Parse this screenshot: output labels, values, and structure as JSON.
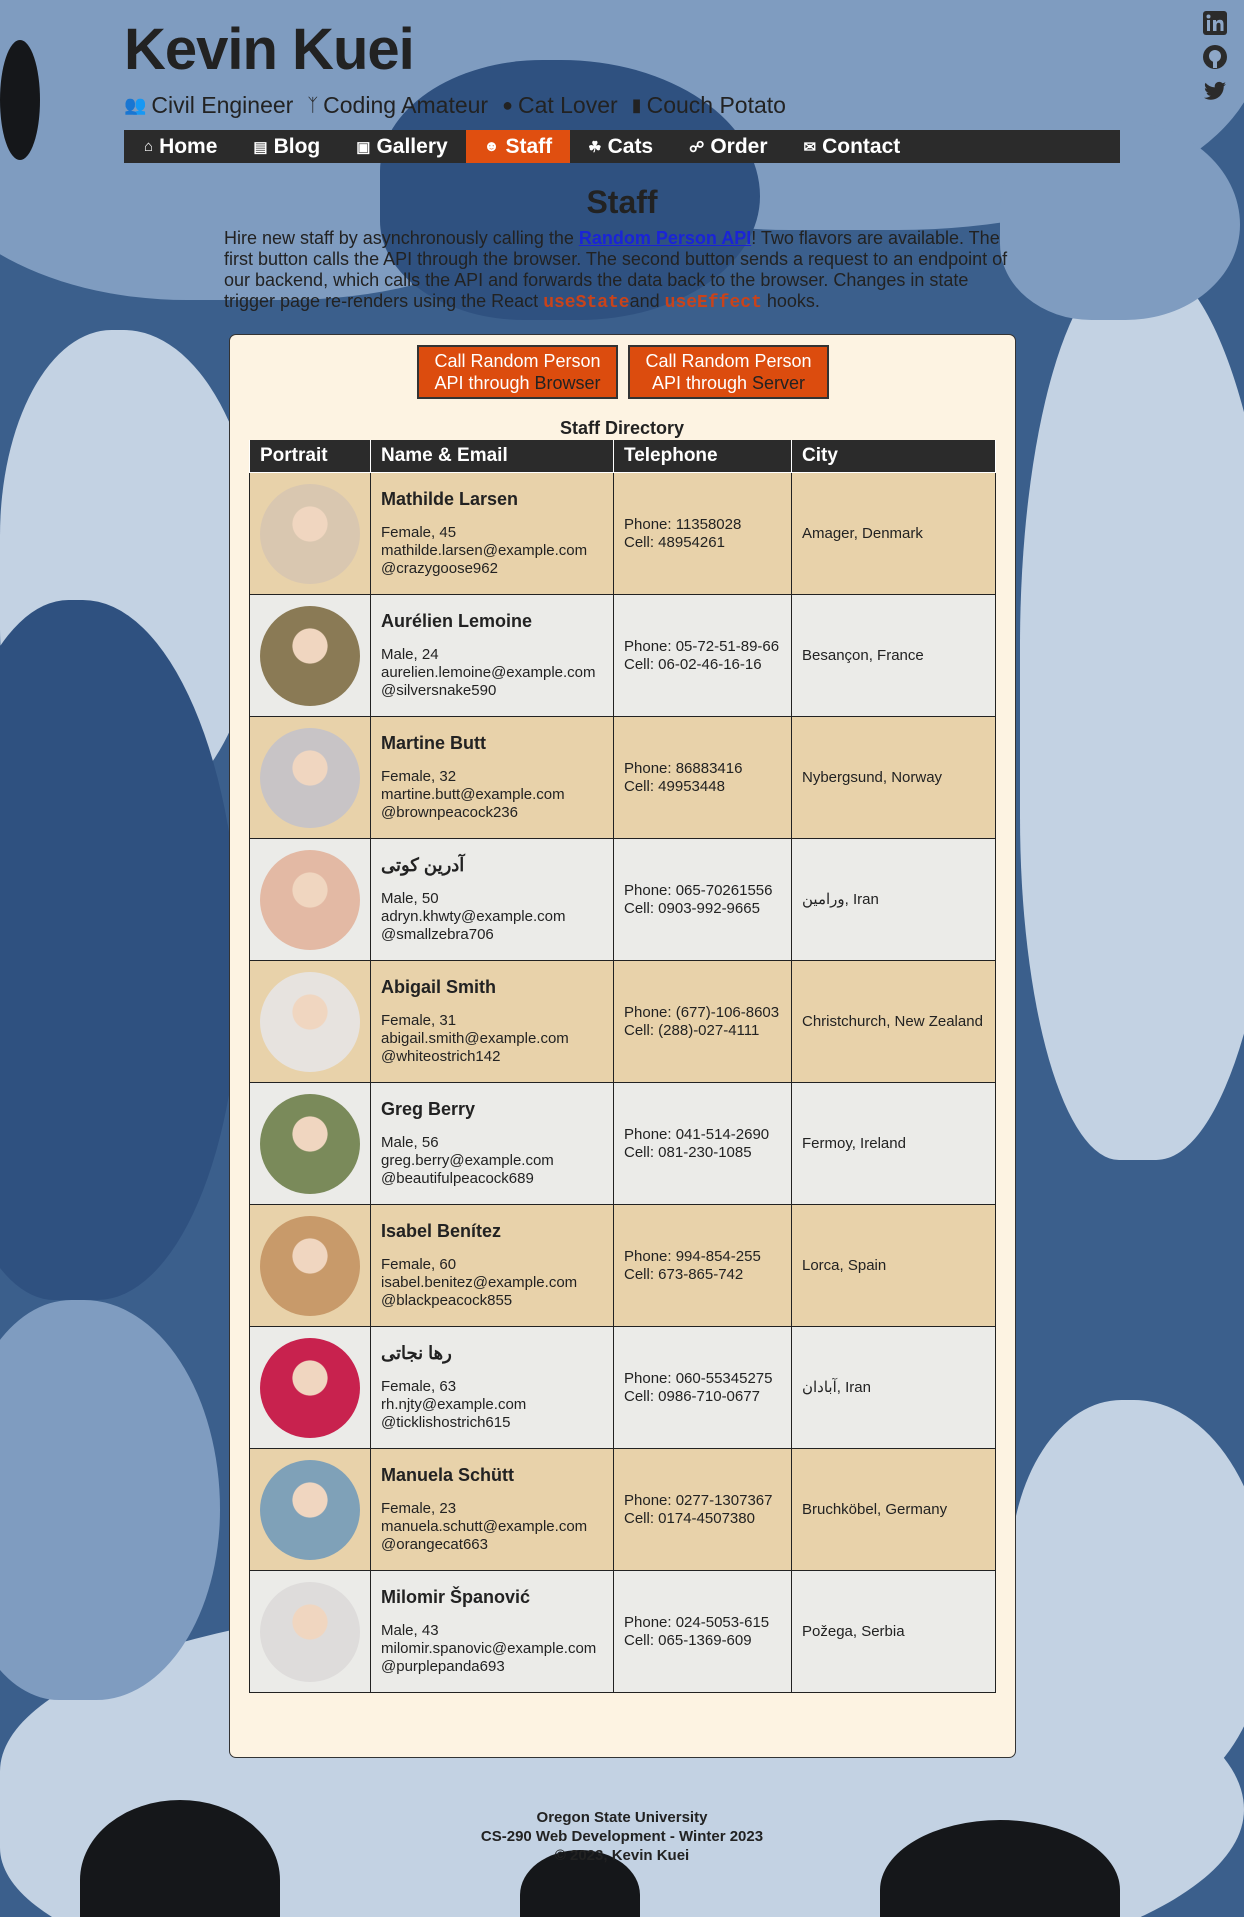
{
  "site": {
    "name": "Kevin Kuei",
    "taglines": [
      {
        "icon": "engineer-icon",
        "label": "Civil Engineer"
      },
      {
        "icon": "branch-icon",
        "label": "Coding Amateur"
      },
      {
        "icon": "paw-icon",
        "label": "Cat Lover"
      },
      {
        "icon": "capsule-icon",
        "label": "Couch Potato"
      }
    ],
    "social": [
      "linkedin-icon",
      "github-icon",
      "twitter-icon"
    ]
  },
  "nav": {
    "items": [
      {
        "label": "Home",
        "icon": "home-icon"
      },
      {
        "label": "Blog",
        "icon": "document-icon"
      },
      {
        "label": "Gallery",
        "icon": "image-icon"
      },
      {
        "label": "Staff",
        "icon": "people-icon"
      },
      {
        "label": "Cats",
        "icon": "cat-icon"
      },
      {
        "label": "Order",
        "icon": "cart-icon"
      },
      {
        "label": "Contact",
        "icon": "envelope-icon"
      }
    ],
    "active": "Staff",
    "active_color": "#e04f10"
  },
  "page": {
    "title": "Staff",
    "intro_before_link": "Hire new staff by asynchronously calling the ",
    "intro_link": "Random Person API",
    "intro_after_link": "! Two flavors are available. The first button calls the API through the browser. The second button sends a request to an endpoint of our backend, which calls the API and forwards the data back to the browser. Changes in state trigger page re-renders using the React ",
    "intro_code1": "useState",
    "intro_and": "and ",
    "intro_code2": "useEffect",
    "intro_end": " hooks."
  },
  "buttons": {
    "browser": {
      "line1": "Call Random Person",
      "line2_prefix": "API through ",
      "line2_emph": "Browser"
    },
    "server": {
      "line1": "Call Random Person",
      "line2_prefix": "API through ",
      "line2_emph": "Server"
    }
  },
  "table": {
    "caption": "Staff Directory",
    "headers": [
      "Portrait",
      "Name & Email",
      "Telephone",
      "City"
    ],
    "rows": [
      {
        "name": "Mathilde Larsen",
        "gender_age": "Female, 45",
        "email": "mathilde.larsen@example.com",
        "username": "@crazygoose962",
        "phone": "Phone: 11358028",
        "cell": "Cell: 48954261",
        "city": "Amager, Denmark",
        "portrait_color": "#d9c7b0"
      },
      {
        "name": "Aurélien Lemoine",
        "gender_age": "Male, 24",
        "email": "aurelien.lemoine@example.com",
        "username": "@silversnake590",
        "phone": "Phone: 05-72-51-89-66",
        "cell": "Cell: 06-02-46-16-16",
        "city": "Besançon, France",
        "portrait_color": "#8a7a55"
      },
      {
        "name": "Martine Butt",
        "gender_age": "Female, 32",
        "email": "martine.butt@example.com",
        "username": "@brownpeacock236",
        "phone": "Phone: 86883416",
        "cell": "Cell: 49953448",
        "city": "Nybergsund, Norway",
        "portrait_color": "#c8c4c6"
      },
      {
        "name": "آدرین کوتی",
        "gender_age": "Male, 50",
        "email": "adryn.khwty@example.com",
        "username": "@smallzebra706",
        "phone": "Phone: 065-70261556",
        "cell": "Cell: 0903-992-9665",
        "city": "ورامین, Iran",
        "portrait_color": "#e3b9a4"
      },
      {
        "name": "Abigail Smith",
        "gender_age": "Female, 31",
        "email": "abigail.smith@example.com",
        "username": "@whiteostrich142",
        "phone": "Phone: (677)-106-8603",
        "cell": "Cell: (288)-027-4111",
        "city": "Christchurch, New Zealand",
        "portrait_color": "#e7e3df"
      },
      {
        "name": "Greg Berry",
        "gender_age": "Male, 56",
        "email": "greg.berry@example.com",
        "username": "@beautifulpeacock689",
        "phone": "Phone: 041-514-2690",
        "cell": "Cell: 081-230-1085",
        "city": "Fermoy, Ireland",
        "portrait_color": "#7a8a5a"
      },
      {
        "name": "Isabel Benítez",
        "gender_age": "Female, 60",
        "email": "isabel.benitez@example.com",
        "username": "@blackpeacock855",
        "phone": "Phone: 994-854-255",
        "cell": "Cell: 673-865-742",
        "city": "Lorca, Spain",
        "portrait_color": "#c89a6a"
      },
      {
        "name": "رها نجاتی",
        "gender_age": "Female, 63",
        "email": "rh.njty@example.com",
        "username": "@ticklishostrich615",
        "phone": "Phone: 060-55345275",
        "cell": "Cell: 0986-710-0677",
        "city": "آبادان, Iran",
        "portrait_color": "#c8224e"
      },
      {
        "name": "Manuela Schütt",
        "gender_age": "Female, 23",
        "email": "manuela.schutt@example.com",
        "username": "@orangecat663",
        "phone": "Phone: 0277-1307367",
        "cell": "Cell: 0174-4507380",
        "city": "Bruchköbel, Germany",
        "portrait_color": "#7fa1b8"
      },
      {
        "name": "Milomir Španović",
        "gender_age": "Male, 43",
        "email": "milomir.spanovic@example.com",
        "username": "@purplepanda693",
        "phone": "Phone: 024-5053-615",
        "cell": "Cell: 065-1369-609",
        "city": "Požega, Serbia",
        "portrait_color": "#dedcdb"
      }
    ]
  },
  "footer": {
    "lines": [
      "Oregon State University",
      "CS-290 Web Development - Winter 2023",
      "© 2023, Kevin Kuei"
    ]
  }
}
